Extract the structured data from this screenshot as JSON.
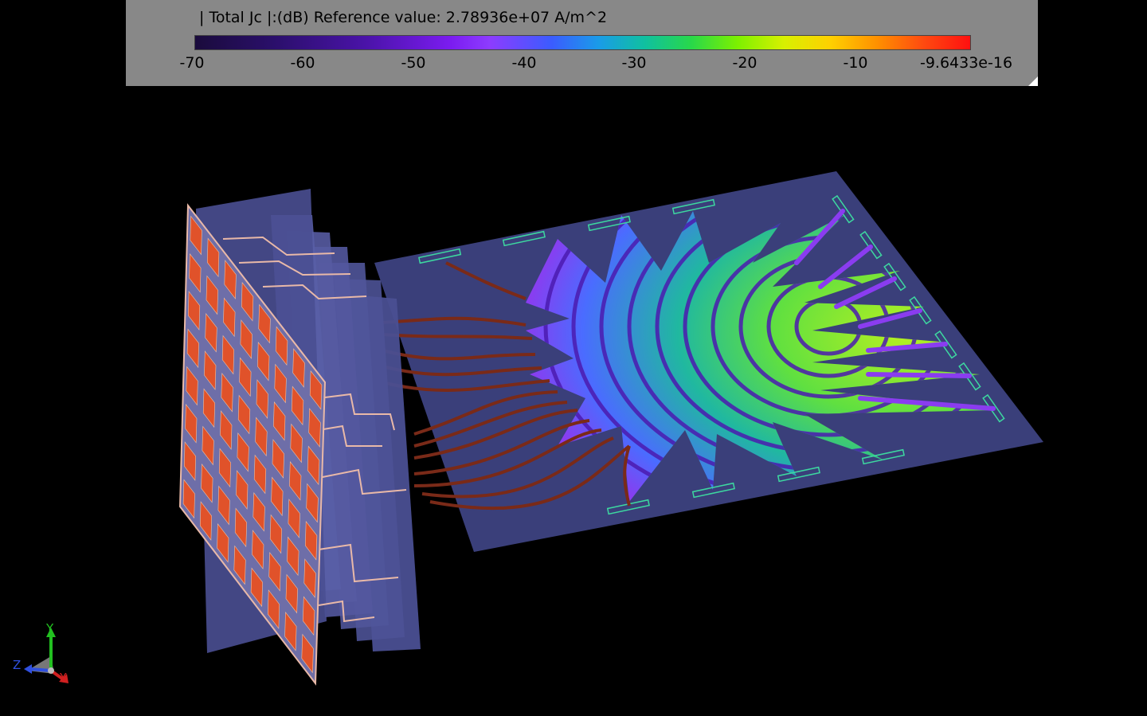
{
  "legend": {
    "title": "| Total Jc |:(dB) Reference value: 2.78936e+07 A/m^2",
    "ticks": [
      "-70",
      "-60",
      "-50",
      "-40",
      "-30",
      "-20",
      "-10",
      "-9.6433e-16"
    ]
  },
  "axes": {
    "x_label": "X",
    "y_label": "Y",
    "z_label": "Z"
  },
  "colors": {
    "panel_bg": "#888888",
    "board": "#3a3f7a",
    "patch": "#e0522a",
    "trace": "#e08a6a",
    "port": "#3dd8a0"
  }
}
